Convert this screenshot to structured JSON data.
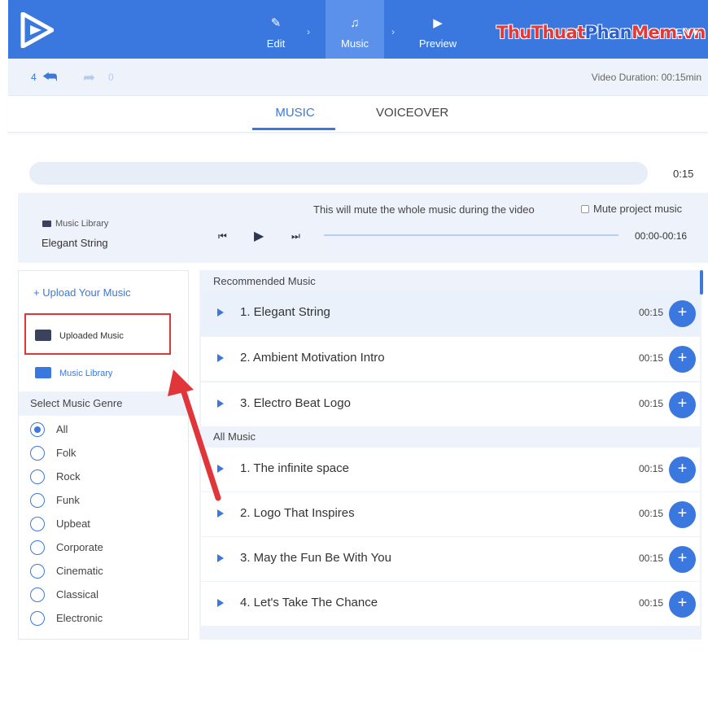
{
  "nav": {
    "steps": [
      {
        "label": "Edit",
        "icon": "pencil-icon"
      },
      {
        "label": "Music",
        "icon": "music-note-icon"
      },
      {
        "label": "Preview",
        "icon": "play-icon"
      }
    ],
    "watermark_1": "ThuThuat",
    "watermark_2": "Phan",
    "watermark_3": "Mem.vn",
    "language": "EN ▾",
    "accent": "#3a78e0"
  },
  "history": {
    "undo_count": "4",
    "redo_count": "0",
    "duration": "Video Duration: 00:15min"
  },
  "tabs": {
    "music": "MUSIC",
    "voiceover": "VOICEOVER",
    "active": "MUSIC"
  },
  "timeline": {
    "time": "0:15"
  },
  "player": {
    "folder": "Music Library",
    "now_playing": "Elegant String",
    "mute_note": "This will mute the whole music during the video",
    "mute_label": "Mute project music",
    "mute_checked": false,
    "range": "00:00-00:16",
    "progress": 0
  },
  "sidebar": {
    "upload": "+ Upload Your Music",
    "uploaded": "Uploaded Music",
    "library": "Music Library",
    "genre_heading": "Select Music Genre",
    "genres": [
      "All",
      "Folk",
      "Rock",
      "Funk",
      "Upbeat",
      "Corporate",
      "Cinematic",
      "Classical",
      "Electronic"
    ],
    "selected_genre": "All"
  },
  "tracks": {
    "recommended_heading": "Recommended Music",
    "recommended": [
      {
        "title": "1. Elegant String",
        "duration": "00:15"
      },
      {
        "title": "2. Ambient Motivation Intro",
        "duration": "00:15"
      },
      {
        "title": "3. Electro Beat Logo",
        "duration": "00:15"
      }
    ],
    "all_heading": "All Music",
    "all": [
      {
        "title": "1. The infinite space",
        "duration": "00:15"
      },
      {
        "title": "2. Logo That Inspires",
        "duration": "00:15"
      },
      {
        "title": "3. May the Fun Be With You",
        "duration": "00:15"
      },
      {
        "title": "4. Let's Take The Chance",
        "duration": "00:15"
      }
    ],
    "add_label": "+"
  }
}
